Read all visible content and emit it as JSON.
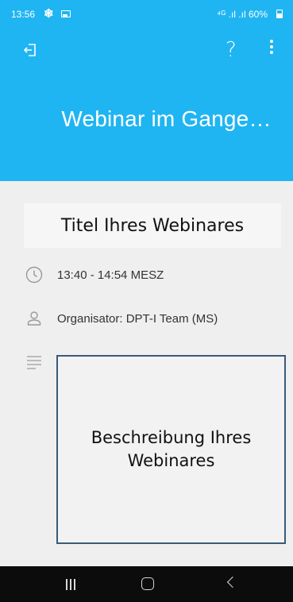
{
  "status_bar": {
    "time": "13:56",
    "network": "⁴ᴳ .ıl .ıl",
    "battery": "60%"
  },
  "header": {
    "title": "Webinar im Gange…",
    "help": "?"
  },
  "webinar": {
    "title": "Titel Ihres Webinares",
    "time": "13:40 - 14:54 MESZ",
    "organizer": "Organisator: DPT-I Team (MS)",
    "description": "Beschreibung Ihres Webinares"
  },
  "colors": {
    "header_bg": "#1fb5f2",
    "page_bg": "#efefef",
    "navbar_bg": "#0c0c0c"
  },
  "icons": [
    "exit-icon",
    "help-icon",
    "more-icon",
    "clock-icon",
    "person-icon",
    "description-icon"
  ]
}
